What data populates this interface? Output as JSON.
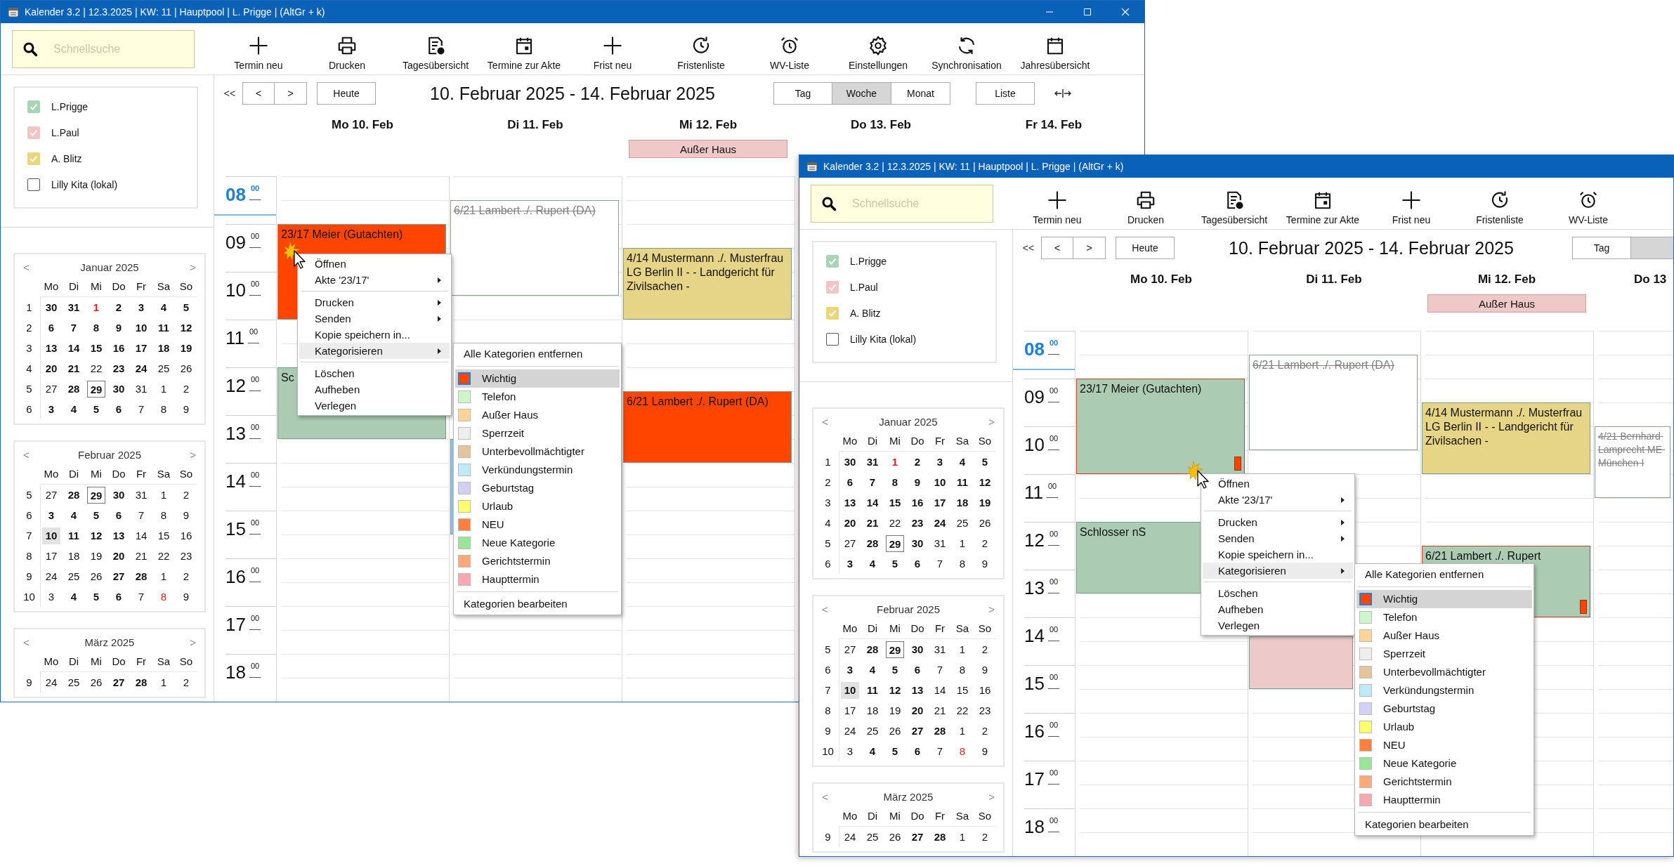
{
  "windows": [
    {
      "title": "Kalender 3.2 | 12.3.2025 | KW: 11 | Hauptpool | L. Prigge | (AltGr + k)",
      "window_buttons": true,
      "search": {
        "placeholder": "Schnellsuche"
      },
      "toolbar": [
        "Termin neu",
        "Drucken",
        "Tagesübersicht",
        "Termine zur Akte",
        "Frist neu",
        "Fristenliste",
        "WV-Liste",
        "Einstellungen",
        "Synchronisation",
        "Jahresübersicht"
      ],
      "calendars": [
        {
          "name": "L.Prigge",
          "checked": true,
          "color": "#a8d5b5"
        },
        {
          "name": "L.Paul",
          "checked": true,
          "color": "#f2c4c4"
        },
        {
          "name": "A. Blitz",
          "checked": true,
          "color": "#ecd57a"
        },
        {
          "name": "Lilly Kita (lokal)",
          "checked": false
        }
      ],
      "mini_calendars": [
        {
          "month": "Januar 2025",
          "prev": "<",
          "next": ">",
          "weekdays": [
            "Mo",
            "Di",
            "Mi",
            "Do",
            "Fr",
            "Sa",
            "So"
          ],
          "weeks": [
            {
              "week": "1",
              "days": [
                {
                  "day": "30",
                  "kind": "busy"
                },
                {
                  "day": "31",
                  "kind": "busy"
                },
                {
                  "day": "1",
                  "kind": "holidaybusy"
                },
                {
                  "day": "2",
                  "kind": "busy"
                },
                {
                  "day": "3",
                  "kind": "busy"
                },
                {
                  "day": "4",
                  "kind": "busy"
                },
                {
                  "day": "5",
                  "kind": "busy"
                }
              ]
            },
            {
              "week": "2",
              "days": [
                {
                  "day": "6",
                  "kind": "busy"
                },
                {
                  "day": "7",
                  "kind": "busy"
                },
                {
                  "day": "8",
                  "kind": "busy"
                },
                {
                  "day": "9",
                  "kind": "busy"
                },
                {
                  "day": "10",
                  "kind": "busy"
                },
                {
                  "day": "11",
                  "kind": "busy"
                },
                {
                  "day": "12",
                  "kind": "busy"
                }
              ]
            },
            {
              "week": "3",
              "days": [
                {
                  "day": "13",
                  "kind": "busy"
                },
                {
                  "day": "14",
                  "kind": "busy"
                },
                {
                  "day": "15",
                  "kind": "busy"
                },
                {
                  "day": "16",
                  "kind": "busy"
                },
                {
                  "day": "17",
                  "kind": "busy"
                },
                {
                  "day": "18",
                  "kind": "busy"
                },
                {
                  "day": "19",
                  "kind": "busy"
                }
              ]
            },
            {
              "week": "4",
              "days": [
                {
                  "day": "20",
                  "kind": "busy"
                },
                {
                  "day": "21",
                  "kind": "busy"
                },
                {
                  "day": "22",
                  "kind": "free"
                },
                {
                  "day": "23",
                  "kind": "busy"
                },
                {
                  "day": "24",
                  "kind": "busy"
                },
                {
                  "day": "25",
                  "kind": "free"
                },
                {
                  "day": "26",
                  "kind": "free"
                }
              ]
            },
            {
              "week": "5",
              "days": [
                {
                  "day": "27",
                  "kind": "free"
                },
                {
                  "day": "28",
                  "kind": "busy"
                },
                {
                  "day": "29",
                  "kind": "boxed"
                },
                {
                  "day": "30",
                  "kind": "busy"
                },
                {
                  "day": "31",
                  "kind": "free"
                },
                {
                  "day": "1",
                  "kind": "free"
                },
                {
                  "day": "2",
                  "kind": "free"
                }
              ]
            },
            {
              "week": "6",
              "days": [
                {
                  "day": "3",
                  "kind": "busy"
                },
                {
                  "day": "4",
                  "kind": "busy"
                },
                {
                  "day": "5",
                  "kind": "busy"
                },
                {
                  "day": "6",
                  "kind": "busy"
                },
                {
                  "day": "7",
                  "kind": "free"
                },
                {
                  "day": "8",
                  "kind": "free"
                },
                {
                  "day": "9",
                  "kind": "free"
                }
              ]
            }
          ]
        },
        {
          "month": "Februar 2025",
          "prev": "<",
          "next": ">",
          "weekdays": [
            "Mo",
            "Di",
            "Mi",
            "Do",
            "Fr",
            "Sa",
            "So"
          ],
          "weeks": [
            {
              "week": "5",
              "days": [
                {
                  "day": "27",
                  "kind": "free"
                },
                {
                  "day": "28",
                  "kind": "busy"
                },
                {
                  "day": "29",
                  "kind": "boxed"
                },
                {
                  "day": "30",
                  "kind": "busy"
                },
                {
                  "day": "31",
                  "kind": "free"
                },
                {
                  "day": "1",
                  "kind": "free"
                },
                {
                  "day": "2",
                  "kind": "free"
                }
              ]
            },
            {
              "week": "6",
              "days": [
                {
                  "day": "3",
                  "kind": "busy"
                },
                {
                  "day": "4",
                  "kind": "busy"
                },
                {
                  "day": "5",
                  "kind": "busy"
                },
                {
                  "day": "6",
                  "kind": "busy"
                },
                {
                  "day": "7",
                  "kind": "free"
                },
                {
                  "day": "8",
                  "kind": "free"
                },
                {
                  "day": "9",
                  "kind": "free"
                }
              ]
            },
            {
              "week": "7",
              "days": [
                {
                  "day": "10",
                  "kind": "current"
                },
                {
                  "day": "11",
                  "kind": "busy"
                },
                {
                  "day": "12",
                  "kind": "busy"
                },
                {
                  "day": "13",
                  "kind": "busy"
                },
                {
                  "day": "14",
                  "kind": "free"
                },
                {
                  "day": "15",
                  "kind": "free"
                },
                {
                  "day": "16",
                  "kind": "free"
                }
              ]
            },
            {
              "week": "8",
              "days": [
                {
                  "day": "17",
                  "kind": "free"
                },
                {
                  "day": "18",
                  "kind": "free"
                },
                {
                  "day": "19",
                  "kind": "free"
                },
                {
                  "day": "20",
                  "kind": "busy"
                },
                {
                  "day": "21",
                  "kind": "free"
                },
                {
                  "day": "22",
                  "kind": "free"
                },
                {
                  "day": "23",
                  "kind": "free"
                }
              ]
            },
            {
              "week": "9",
              "days": [
                {
                  "day": "24",
                  "kind": "free"
                },
                {
                  "day": "25",
                  "kind": "free"
                },
                {
                  "day": "26",
                  "kind": "free"
                },
                {
                  "day": "27",
                  "kind": "busy"
                },
                {
                  "day": "28",
                  "kind": "busy"
                },
                {
                  "day": "1",
                  "kind": "free"
                },
                {
                  "day": "2",
                  "kind": "free"
                }
              ]
            },
            {
              "week": "10",
              "days": [
                {
                  "day": "3",
                  "kind": "free"
                },
                {
                  "day": "4",
                  "kind": "busy"
                },
                {
                  "day": "5",
                  "kind": "busy"
                },
                {
                  "day": "6",
                  "kind": "busy"
                },
                {
                  "day": "7",
                  "kind": "free"
                },
                {
                  "day": "8",
                  "kind": "holiday"
                },
                {
                  "day": "9",
                  "kind": "free"
                }
              ]
            }
          ]
        },
        {
          "month": "März 2025",
          "prev": "<",
          "next": ">",
          "weekdays": [
            "Mo",
            "Di",
            "Mi",
            "Do",
            "Fr",
            "Sa",
            "So"
          ],
          "weeks": [
            {
              "week": "9",
              "days": [
                {
                  "day": "24",
                  "kind": "free"
                },
                {
                  "day": "25",
                  "kind": "free"
                },
                {
                  "day": "26",
                  "kind": "free"
                },
                {
                  "day": "27",
                  "kind": "busy"
                },
                {
                  "day": "28",
                  "kind": "busy"
                },
                {
                  "day": "1",
                  "kind": "free"
                },
                {
                  "day": "2",
                  "kind": "free"
                }
              ]
            }
          ]
        }
      ],
      "nav": {
        "back": "<<",
        "prev": "<",
        "next": ">",
        "today": "Heute"
      },
      "range_title": "10. Februar 2025 - 14. Februar 2025",
      "views": [
        {
          "label": "Tag",
          "selected": false
        },
        {
          "label": "Woche",
          "selected": true
        },
        {
          "label": "Monat",
          "selected": false
        }
      ],
      "list_button": "Liste",
      "days": [
        {
          "label": "Mo 10. Feb"
        },
        {
          "label": "Di 11. Feb"
        },
        {
          "label": "Mi 12. Feb",
          "all_day": [
            {
              "title": "Außer Haus",
              "color": "#efc8c8"
            }
          ]
        },
        {
          "label": "Do 13. Feb"
        },
        {
          "label": "Fr 14. Feb"
        }
      ],
      "hours": [
        {
          "hour": "08",
          "minute": "00",
          "current": true
        },
        {
          "hour": "09",
          "minute": "00",
          "current": false
        },
        {
          "hour": "10",
          "minute": "00",
          "current": false
        },
        {
          "hour": "11",
          "minute": "00",
          "current": false
        },
        {
          "hour": "12",
          "minute": "00",
          "current": false
        },
        {
          "hour": "13",
          "minute": "00",
          "current": false
        },
        {
          "hour": "14",
          "minute": "00",
          "current": false
        },
        {
          "hour": "15",
          "minute": "00",
          "current": false
        },
        {
          "hour": "16",
          "minute": "00",
          "current": false
        },
        {
          "hour": "17",
          "minute": "00",
          "current": false
        },
        {
          "hour": "18",
          "minute": "00",
          "current": false
        }
      ],
      "events": [
        {
          "title": "23/17 Meier (Gutachten)",
          "color": "#ff4500",
          "struck": false,
          "important": false
        },
        {
          "title": "Sc",
          "color": "#abcbb3",
          "struck": false,
          "important": false
        },
        {
          "title": "6/21 Lambert ./. Rupert (DA)",
          "color": "#ffffff",
          "struck": true,
          "important": false
        },
        {
          "color": "#9cc3e6"
        },
        {
          "title": "4/14 Mustermann ./. Musterfrau  LG Berlin II - - Landgericht für Zivilsachen -",
          "color": "#e6d586",
          "struck": false,
          "important": false
        },
        {
          "title": "6/21 Lambert ./. Rupert (DA)",
          "color": "#ff4500",
          "struck": false,
          "important": false
        }
      ],
      "context_menu": [
        {
          "kind": "item",
          "label": "Öffnen",
          "submenu": false,
          "highlighted": false
        },
        {
          "kind": "item",
          "label": "Akte '23/17'",
          "submenu": true,
          "highlighted": false
        },
        {
          "kind": "separator"
        },
        {
          "kind": "item",
          "label": "Drucken",
          "submenu": true,
          "highlighted": false
        },
        {
          "kind": "item",
          "label": "Senden",
          "submenu": true,
          "highlighted": false
        },
        {
          "kind": "item",
          "label": "Kopie speichern in...",
          "submenu": false,
          "highlighted": false
        },
        {
          "kind": "item",
          "label": "Kategorisieren",
          "submenu": true,
          "highlighted": true
        },
        {
          "kind": "separator"
        },
        {
          "kind": "item",
          "label": "Löschen",
          "submenu": false,
          "highlighted": false
        },
        {
          "kind": "item",
          "label": "Aufheben",
          "submenu": false,
          "highlighted": false
        },
        {
          "kind": "item",
          "label": "Verlegen",
          "submenu": false,
          "highlighted": false
        }
      ],
      "category_menu": [
        {
          "kind": "action",
          "label": "Alle Kategorien entfernen",
          "highlighted": false
        },
        {
          "kind": "separator"
        },
        {
          "kind": "category",
          "label": "Wichtig",
          "color": "#ff4500",
          "highlighted": true
        },
        {
          "kind": "category",
          "label": "Telefon",
          "color": "#ccf7cc",
          "highlighted": false
        },
        {
          "kind": "category",
          "label": "Außer Haus",
          "color": "#ffd494",
          "highlighted": false
        },
        {
          "kind": "category",
          "label": "Sperrzeit",
          "color": "#eeeeee",
          "highlighted": false
        },
        {
          "kind": "category",
          "label": "Unterbevollmächtigter",
          "color": "#e6c49a",
          "highlighted": false
        },
        {
          "kind": "category",
          "label": "Verkündungstermin",
          "color": "#bfeaf7",
          "highlighted": false
        },
        {
          "kind": "category",
          "label": "Geburtstag",
          "color": "#d2d0f7",
          "highlighted": false
        },
        {
          "kind": "category",
          "label": "Urlaub",
          "color": "#ffff6e",
          "highlighted": false
        },
        {
          "kind": "category",
          "label": "NEU",
          "color": "#ff7f3f",
          "highlighted": false
        },
        {
          "kind": "category",
          "label": "Neue Kategorie",
          "color": "#99e699",
          "highlighted": false
        },
        {
          "kind": "category",
          "label": "Gerichtstermin",
          "color": "#ffa97a",
          "highlighted": false
        },
        {
          "kind": "category",
          "label": "Haupttermin",
          "color": "#f7a8b0",
          "highlighted": false
        },
        {
          "kind": "separator"
        },
        {
          "kind": "action",
          "label": "Kategorien bearbeiten",
          "highlighted": false
        }
      ]
    },
    {
      "title": "Kalender 3.2 | 12.3.2025 | KW: 11 | Hauptpool | L. Prigge | (AltGr + k)",
      "window_buttons": false,
      "search": {
        "placeholder": "Schnellsuche"
      },
      "toolbar": [
        "Termin neu",
        "Drucken",
        "Tagesübersicht",
        "Termine zur Akte",
        "Frist neu",
        "Fristenliste",
        "WV-Liste"
      ],
      "calendars": [
        {
          "name": "L.Prigge",
          "checked": true,
          "color": "#a8d5b5"
        },
        {
          "name": "L.Paul",
          "checked": true,
          "color": "#f2c4c4"
        },
        {
          "name": "A. Blitz",
          "checked": true,
          "color": "#ecd57a"
        },
        {
          "name": "Lilly Kita (lokal)",
          "checked": false
        }
      ],
      "mini_calendars": [
        {
          "month": "Januar 2025",
          "prev": "<",
          "next": ">",
          "weekdays": [
            "Mo",
            "Di",
            "Mi",
            "Do",
            "Fr",
            "Sa",
            "So"
          ],
          "weeks": [
            {
              "week": "1",
              "days": [
                {
                  "day": "30",
                  "kind": "busy"
                },
                {
                  "day": "31",
                  "kind": "busy"
                },
                {
                  "day": "1",
                  "kind": "holidaybusy"
                },
                {
                  "day": "2",
                  "kind": "busy"
                },
                {
                  "day": "3",
                  "kind": "busy"
                },
                {
                  "day": "4",
                  "kind": "busy"
                },
                {
                  "day": "5",
                  "kind": "busy"
                }
              ]
            },
            {
              "week": "2",
              "days": [
                {
                  "day": "6",
                  "kind": "busy"
                },
                {
                  "day": "7",
                  "kind": "busy"
                },
                {
                  "day": "8",
                  "kind": "busy"
                },
                {
                  "day": "9",
                  "kind": "busy"
                },
                {
                  "day": "10",
                  "kind": "busy"
                },
                {
                  "day": "11",
                  "kind": "busy"
                },
                {
                  "day": "12",
                  "kind": "busy"
                }
              ]
            },
            {
              "week": "3",
              "days": [
                {
                  "day": "13",
                  "kind": "busy"
                },
                {
                  "day": "14",
                  "kind": "busy"
                },
                {
                  "day": "15",
                  "kind": "busy"
                },
                {
                  "day": "16",
                  "kind": "busy"
                },
                {
                  "day": "17",
                  "kind": "busy"
                },
                {
                  "day": "18",
                  "kind": "busy"
                },
                {
                  "day": "19",
                  "kind": "busy"
                }
              ]
            },
            {
              "week": "4",
              "days": [
                {
                  "day": "20",
                  "kind": "busy"
                },
                {
                  "day": "21",
                  "kind": "busy"
                },
                {
                  "day": "22",
                  "kind": "free"
                },
                {
                  "day": "23",
                  "kind": "busy"
                },
                {
                  "day": "24",
                  "kind": "busy"
                },
                {
                  "day": "25",
                  "kind": "free"
                },
                {
                  "day": "26",
                  "kind": "free"
                }
              ]
            },
            {
              "week": "5",
              "days": [
                {
                  "day": "27",
                  "kind": "free"
                },
                {
                  "day": "28",
                  "kind": "busy"
                },
                {
                  "day": "29",
                  "kind": "boxed"
                },
                {
                  "day": "30",
                  "kind": "busy"
                },
                {
                  "day": "31",
                  "kind": "free"
                },
                {
                  "day": "1",
                  "kind": "free"
                },
                {
                  "day": "2",
                  "kind": "free"
                }
              ]
            },
            {
              "week": "6",
              "days": [
                {
                  "day": "3",
                  "kind": "busy"
                },
                {
                  "day": "4",
                  "kind": "busy"
                },
                {
                  "day": "5",
                  "kind": "busy"
                },
                {
                  "day": "6",
                  "kind": "busy"
                },
                {
                  "day": "7",
                  "kind": "free"
                },
                {
                  "day": "8",
                  "kind": "free"
                },
                {
                  "day": "9",
                  "kind": "free"
                }
              ]
            }
          ]
        },
        {
          "month": "Februar 2025",
          "prev": "<",
          "next": ">",
          "weekdays": [
            "Mo",
            "Di",
            "Mi",
            "Do",
            "Fr",
            "Sa",
            "So"
          ],
          "weeks": [
            {
              "week": "5",
              "days": [
                {
                  "day": "27",
                  "kind": "free"
                },
                {
                  "day": "28",
                  "kind": "busy"
                },
                {
                  "day": "29",
                  "kind": "boxed"
                },
                {
                  "day": "30",
                  "kind": "busy"
                },
                {
                  "day": "31",
                  "kind": "free"
                },
                {
                  "day": "1",
                  "kind": "free"
                },
                {
                  "day": "2",
                  "kind": "free"
                }
              ]
            },
            {
              "week": "6",
              "days": [
                {
                  "day": "3",
                  "kind": "busy"
                },
                {
                  "day": "4",
                  "kind": "busy"
                },
                {
                  "day": "5",
                  "kind": "busy"
                },
                {
                  "day": "6",
                  "kind": "busy"
                },
                {
                  "day": "7",
                  "kind": "free"
                },
                {
                  "day": "8",
                  "kind": "free"
                },
                {
                  "day": "9",
                  "kind": "free"
                }
              ]
            },
            {
              "week": "7",
              "days": [
                {
                  "day": "10",
                  "kind": "current"
                },
                {
                  "day": "11",
                  "kind": "busy"
                },
                {
                  "day": "12",
                  "kind": "busy"
                },
                {
                  "day": "13",
                  "kind": "busy"
                },
                {
                  "day": "14",
                  "kind": "free"
                },
                {
                  "day": "15",
                  "kind": "free"
                },
                {
                  "day": "16",
                  "kind": "free"
                }
              ]
            },
            {
              "week": "8",
              "days": [
                {
                  "day": "17",
                  "kind": "free"
                },
                {
                  "day": "18",
                  "kind": "free"
                },
                {
                  "day": "19",
                  "kind": "free"
                },
                {
                  "day": "20",
                  "kind": "busy"
                },
                {
                  "day": "21",
                  "kind": "free"
                },
                {
                  "day": "22",
                  "kind": "free"
                },
                {
                  "day": "23",
                  "kind": "free"
                }
              ]
            },
            {
              "week": "9",
              "days": [
                {
                  "day": "24",
                  "kind": "free"
                },
                {
                  "day": "25",
                  "kind": "free"
                },
                {
                  "day": "26",
                  "kind": "free"
                },
                {
                  "day": "27",
                  "kind": "busy"
                },
                {
                  "day": "28",
                  "kind": "busy"
                },
                {
                  "day": "1",
                  "kind": "free"
                },
                {
                  "day": "2",
                  "kind": "free"
                }
              ]
            },
            {
              "week": "10",
              "days": [
                {
                  "day": "3",
                  "kind": "free"
                },
                {
                  "day": "4",
                  "kind": "busy"
                },
                {
                  "day": "5",
                  "kind": "busy"
                },
                {
                  "day": "6",
                  "kind": "busy"
                },
                {
                  "day": "7",
                  "kind": "free"
                },
                {
                  "day": "8",
                  "kind": "holiday"
                },
                {
                  "day": "9",
                  "kind": "free"
                }
              ]
            }
          ]
        },
        {
          "month": "März 2025",
          "prev": "<",
          "next": ">",
          "weekdays": [
            "Mo",
            "Di",
            "Mi",
            "Do",
            "Fr",
            "Sa",
            "So"
          ],
          "weeks": [
            {
              "week": "9",
              "days": [
                {
                  "day": "24",
                  "kind": "free"
                },
                {
                  "day": "25",
                  "kind": "free"
                },
                {
                  "day": "26",
                  "kind": "free"
                },
                {
                  "day": "27",
                  "kind": "busy"
                },
                {
                  "day": "28",
                  "kind": "busy"
                },
                {
                  "day": "1",
                  "kind": "free"
                },
                {
                  "day": "2",
                  "kind": "free"
                }
              ]
            }
          ]
        }
      ],
      "nav": {
        "back": "<<",
        "prev": "<",
        "next": ">",
        "today": "Heute"
      },
      "range_title": "10. Februar 2025 - 14. Februar 2025",
      "views": [
        {
          "label": "Tag",
          "selected": false
        },
        {
          "selected": true
        }
      ],
      "days": [
        {
          "label": "Mo 10. Feb"
        },
        {
          "label": "Di 11. Feb"
        },
        {
          "label": "Mi 12. Feb",
          "all_day": [
            {
              "title": "Außer Haus",
              "color": "#efc8c8"
            }
          ]
        },
        {
          "label": "Do 13"
        }
      ],
      "hours": [
        {
          "hour": "08",
          "minute": "00",
          "current": true
        },
        {
          "hour": "09",
          "minute": "00",
          "current": false
        },
        {
          "hour": "10",
          "minute": "00",
          "current": false
        },
        {
          "hour": "11",
          "minute": "00",
          "current": false
        },
        {
          "hour": "12",
          "minute": "00",
          "current": false
        },
        {
          "hour": "13",
          "minute": "00",
          "current": false
        },
        {
          "hour": "14",
          "minute": "00",
          "current": false
        },
        {
          "hour": "15",
          "minute": "00",
          "current": false
        },
        {
          "hour": "16",
          "minute": "00",
          "current": false
        },
        {
          "hour": "17",
          "minute": "00",
          "current": false
        },
        {
          "hour": "18",
          "minute": "00",
          "current": false
        }
      ],
      "events": [
        {
          "title": "23/17 Meier (Gutachten)",
          "color": "#abcbb3",
          "struck": false,
          "important": true
        },
        {
          "title": "Schlosser nS",
          "color": "#abcbb3",
          "struck": false,
          "important": false
        },
        {
          "title": "6/21 Lambert ./. Rupert (DA)",
          "color": "#ffffff",
          "struck": true,
          "important": false
        },
        {
          "color": "#eec9c9"
        },
        {
          "title": "4/14 Mustermann ./. Musterfrau  LG Berlin II - - Landgericht für Zivilsachen -",
          "color": "#e6d586",
          "struck": false,
          "important": false
        },
        {
          "title": "6/21 Lambert ./. Rupert",
          "color": "#abcbb3",
          "struck": false,
          "important": true
        },
        {
          "title": "4/21 Bernhard Lamprecht ME München I",
          "color": "#ffffff",
          "struck": true,
          "important": false
        }
      ],
      "context_menu": [
        {
          "kind": "item",
          "label": "Öffnen",
          "submenu": false,
          "highlighted": false
        },
        {
          "kind": "item",
          "label": "Akte '23/17'",
          "submenu": true,
          "highlighted": false
        },
        {
          "kind": "separator"
        },
        {
          "kind": "item",
          "label": "Drucken",
          "submenu": true,
          "highlighted": false
        },
        {
          "kind": "item",
          "label": "Senden",
          "submenu": true,
          "highlighted": false
        },
        {
          "kind": "item",
          "label": "Kopie speichern in...",
          "submenu": false,
          "highlighted": false
        },
        {
          "kind": "item",
          "label": "Kategorisieren",
          "submenu": true,
          "highlighted": true
        },
        {
          "kind": "separator"
        },
        {
          "kind": "item",
          "label": "Löschen",
          "submenu": false,
          "highlighted": false
        },
        {
          "kind": "item",
          "label": "Aufheben",
          "submenu": false,
          "highlighted": false
        },
        {
          "kind": "item",
          "label": "Verlegen",
          "submenu": false,
          "highlighted": false
        }
      ],
      "category_menu": [
        {
          "kind": "action",
          "label": "Alle Kategorien entfernen",
          "highlighted": false
        },
        {
          "kind": "separator"
        },
        {
          "kind": "category",
          "label": "Wichtig",
          "color": "#ff4500",
          "highlighted": true
        },
        {
          "kind": "category",
          "label": "Telefon",
          "color": "#ccf7cc",
          "highlighted": false
        },
        {
          "kind": "category",
          "label": "Außer Haus",
          "color": "#ffd494",
          "highlighted": false
        },
        {
          "kind": "category",
          "label": "Sperrzeit",
          "color": "#eeeeee",
          "highlighted": false
        },
        {
          "kind": "category",
          "label": "Unterbevollmächtigter",
          "color": "#e6c49a",
          "highlighted": false
        },
        {
          "kind": "category",
          "label": "Verkündungstermin",
          "color": "#bfeaf7",
          "highlighted": false
        },
        {
          "kind": "category",
          "label": "Geburtstag",
          "color": "#d2d0f7",
          "highlighted": false
        },
        {
          "kind": "category",
          "label": "Urlaub",
          "color": "#ffff6e",
          "highlighted": false
        },
        {
          "kind": "category",
          "label": "NEU",
          "color": "#ff7f3f",
          "highlighted": false
        },
        {
          "kind": "category",
          "label": "Neue Kategorie",
          "color": "#99e699",
          "highlighted": false
        },
        {
          "kind": "category",
          "label": "Gerichtstermin",
          "color": "#ffa97a",
          "highlighted": false
        },
        {
          "kind": "category",
          "label": "Haupttermin",
          "color": "#f7a8b0",
          "highlighted": false
        },
        {
          "kind": "separator"
        },
        {
          "kind": "action",
          "label": "Kategorien bearbeiten",
          "highlighted": false
        }
      ]
    }
  ]
}
